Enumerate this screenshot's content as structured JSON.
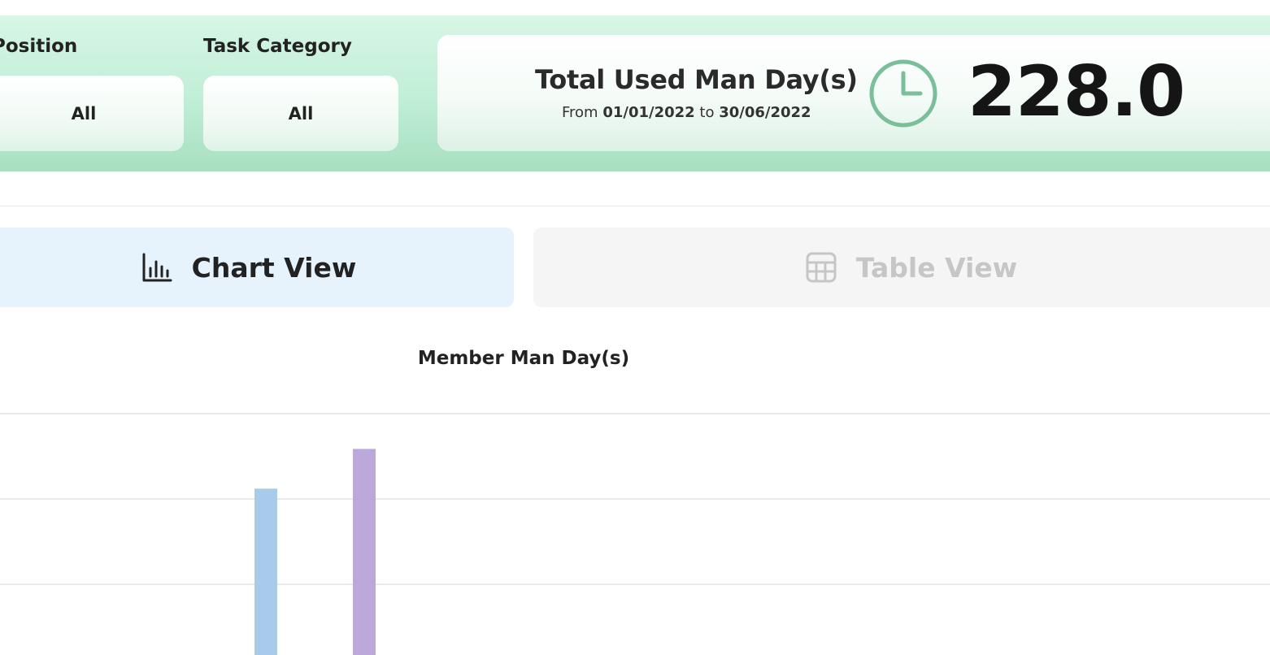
{
  "filters": {
    "position_label": "Position",
    "position_value": "All",
    "task_category_label": "Task Category",
    "task_category_value": "All"
  },
  "total": {
    "title": "Total Used Man Day(s)",
    "from_word": "From",
    "from_date": "01/01/2022",
    "to_word": "to",
    "to_date": "30/06/2022",
    "value": "228.0",
    "icon": "clock-icon"
  },
  "views": {
    "chart_label": "Chart View",
    "chart_icon": "bar-chart-icon",
    "table_label": "Table View",
    "table_icon": "table-icon",
    "active": "chart"
  },
  "colors": {
    "header_green": "#bfeed6",
    "clock_green": "#79bf99",
    "chart_tab_bg": "#e6f3fd",
    "table_tab_bg": "#f5f5f5",
    "bar_blue": "#a8cbeb",
    "bar_purple": "#bea8db"
  },
  "chart_data": {
    "type": "bar",
    "title": "Member Man Day(s)",
    "xlabel": "",
    "ylabel": "",
    "grid": true,
    "gridlines": 3,
    "series": [
      {
        "color": "#a8cbeb",
        "values": [
          0.72
        ]
      },
      {
        "color": "#bea8db",
        "values": [
          0.87
        ]
      }
    ],
    "ylim": [
      0,
      1
    ],
    "note_visible": "bars partially cut off at bottom of viewport"
  }
}
